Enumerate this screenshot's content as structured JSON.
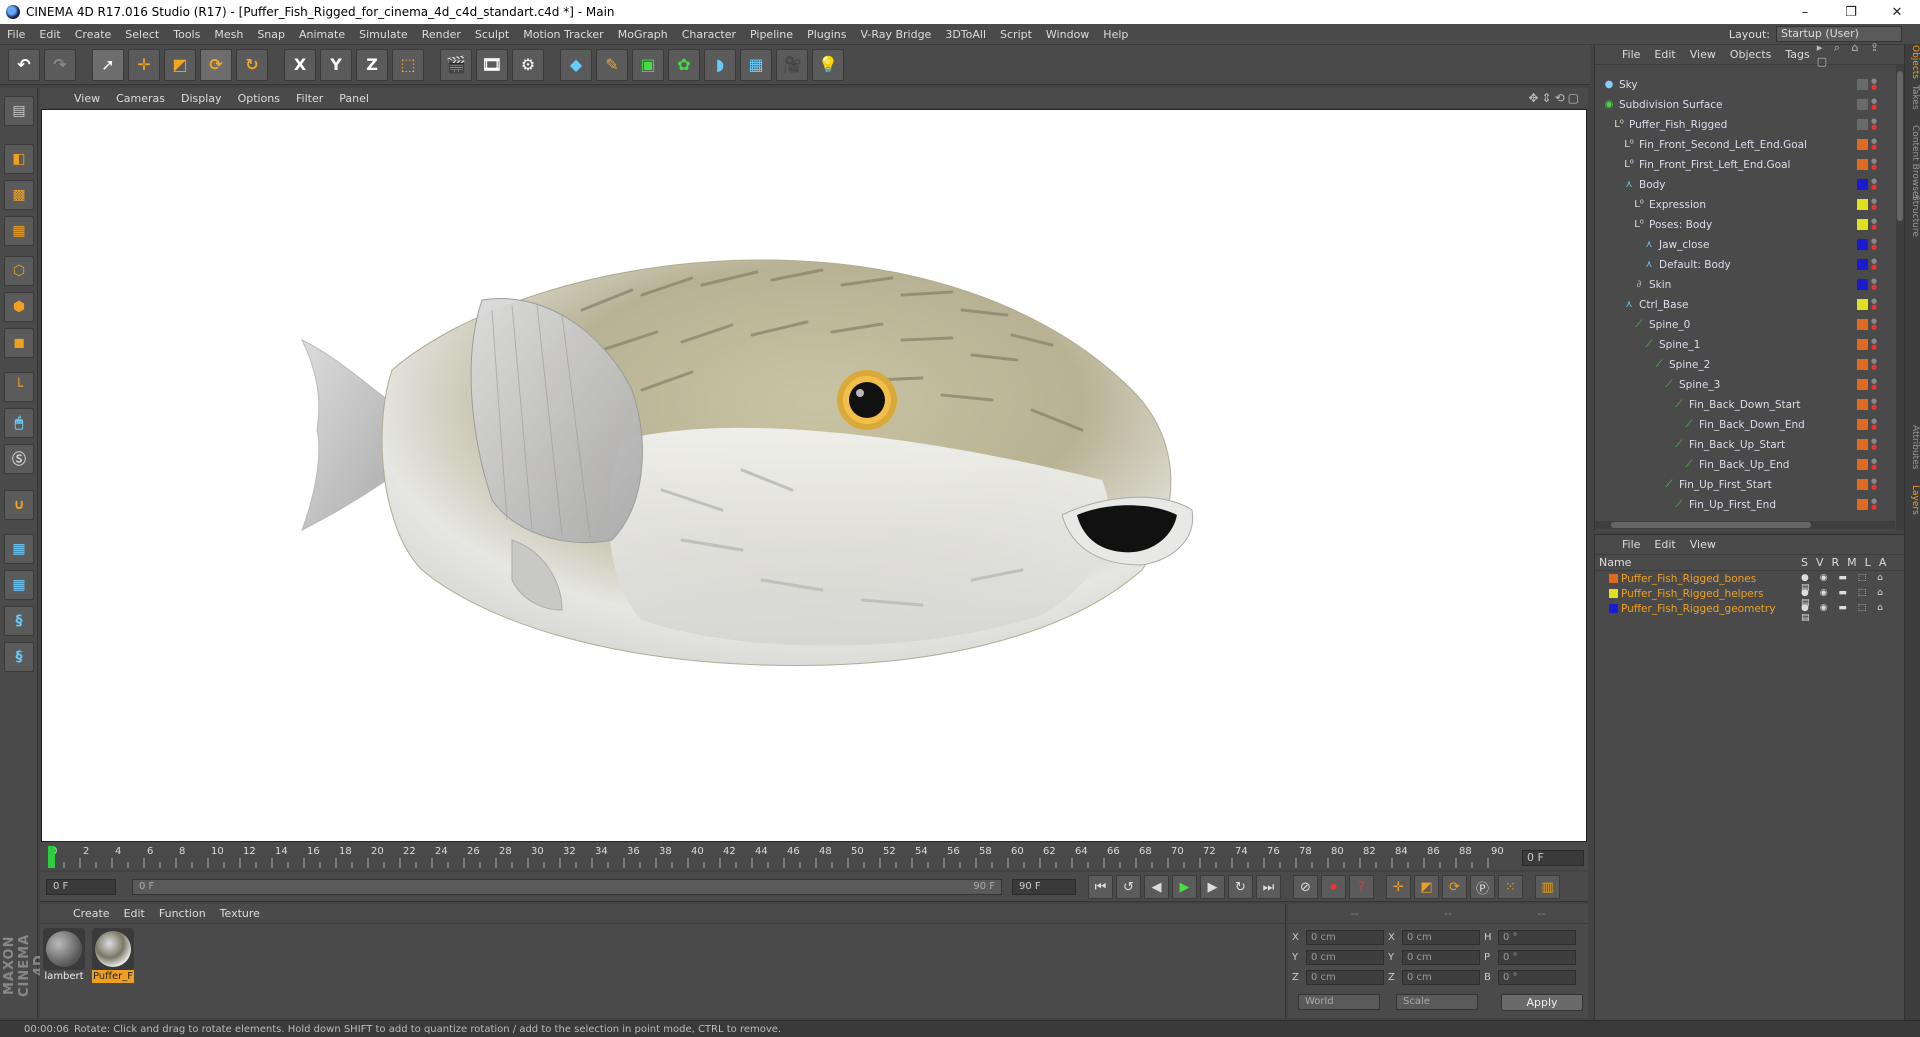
{
  "window": {
    "title": "CINEMA 4D R17.016 Studio (R17) - [Puffer_Fish_Rigged_for_cinema_4d_c4d_standart.c4d *] - Main",
    "controls": [
      "–",
      "❐",
      "✕"
    ]
  },
  "menubar": {
    "items": [
      "File",
      "Edit",
      "Create",
      "Select",
      "Tools",
      "Mesh",
      "Snap",
      "Animate",
      "Simulate",
      "Render",
      "Sculpt",
      "Motion Tracker",
      "MoGraph",
      "Character",
      "Pipeline",
      "Plugins",
      "V-Ray Bridge",
      "3DToAll",
      "Script",
      "Window",
      "Help"
    ],
    "layout_label": "Layout:",
    "layout_value": "Startup (User)"
  },
  "toolbar": {
    "icons": [
      "undo-icon",
      "redo-icon",
      "live-selection-icon",
      "move-icon",
      "scale-icon",
      "rotate-icon",
      "recent-tool-icon",
      "x-axis-icon",
      "y-axis-icon",
      "z-axis-icon",
      "coordinate-system-icon",
      "render-view-icon",
      "render-picture-viewer-icon",
      "render-settings-icon",
      "cube-icon",
      "pen-icon",
      "subdivision-icon",
      "mograph-cloner-icon",
      "deformer-icon",
      "floor-icon",
      "camera-icon",
      "light-icon"
    ],
    "axis_x": "X",
    "axis_y": "Y",
    "axis_z": "Z"
  },
  "viewport": {
    "menu": [
      "View",
      "Cameras",
      "Display",
      "Options",
      "Filter",
      "Panel"
    ],
    "nav_icons": "✥⇕⟲▢"
  },
  "timeline": {
    "ticks": [
      "0",
      "2",
      "4",
      "6",
      "8",
      "10",
      "12",
      "14",
      "16",
      "18",
      "20",
      "22",
      "24",
      "26",
      "28",
      "30",
      "32",
      "34",
      "36",
      "38",
      "40",
      "42",
      "44",
      "46",
      "48",
      "50",
      "52",
      "54",
      "56",
      "58",
      "60",
      "62",
      "64",
      "66",
      "68",
      "70",
      "72",
      "74",
      "76",
      "78",
      "80",
      "82",
      "84",
      "86",
      "88",
      "90"
    ],
    "current_frame": "0 F"
  },
  "transport": {
    "start": "0 F",
    "slider_start": "0 F",
    "slider_end": "90 F",
    "end": "90 F"
  },
  "materials": {
    "menu": [
      "Create",
      "Edit",
      "Function",
      "Texture"
    ],
    "items": [
      {
        "name": "lambert",
        "selected": false
      },
      {
        "name": "Puffer_F",
        "selected": true
      }
    ]
  },
  "coordinates": {
    "headers": [
      "--",
      "--",
      "--"
    ],
    "rows": [
      {
        "a": "X",
        "av": "0 cm",
        "b": "X",
        "bv": "0 cm",
        "c": "H",
        "cv": "0 °"
      },
      {
        "a": "Y",
        "av": "0 cm",
        "b": "Y",
        "bv": "0 cm",
        "c": "P",
        "cv": "0 °"
      },
      {
        "a": "Z",
        "av": "0 cm",
        "b": "Z",
        "bv": "0 cm",
        "c": "B",
        "cv": "0 °"
      }
    ],
    "world": "World",
    "scale": "Scale",
    "apply": "Apply"
  },
  "status": {
    "time": "00:00:06",
    "message": "Rotate: Click and drag to rotate elements. Hold down SHIFT to add to quantize rotation / add to the selection in point mode, CTRL to remove."
  },
  "object_manager": {
    "menu": [
      "File",
      "Edit",
      "View",
      "Objects",
      "Tags"
    ],
    "objects": [
      {
        "name": "Sky",
        "indent": 0,
        "icon": "sky-icon",
        "tag": "#6a6a6a"
      },
      {
        "name": "Subdivision Surface",
        "indent": 0,
        "icon": "subdivision-icon",
        "tag": "#6a6a6a"
      },
      {
        "name": "Puffer_Fish_Rigged",
        "indent": 1,
        "icon": "null-icon",
        "tag": "#6a6a6a"
      },
      {
        "name": "Fin_Front_Second_Left_End.Goal",
        "indent": 2,
        "icon": "null-icon",
        "tag": "#e06a20"
      },
      {
        "name": "Fin_Front_First_Left_End.Goal",
        "indent": 2,
        "icon": "null-icon",
        "tag": "#e06a20"
      },
      {
        "name": "Body",
        "indent": 2,
        "icon": "mesh-icon",
        "tag": "#1a1ad0"
      },
      {
        "name": "Expression",
        "indent": 3,
        "icon": "null-icon",
        "tag": "#e0e020"
      },
      {
        "name": "Poses: Body",
        "indent": 3,
        "icon": "null-icon",
        "tag": "#e0e020"
      },
      {
        "name": "Jaw_close",
        "indent": 4,
        "icon": "mesh-icon",
        "tag": "#1a1ad0"
      },
      {
        "name": "Default: Body",
        "indent": 4,
        "icon": "mesh-icon",
        "tag": "#1a1ad0"
      },
      {
        "name": "Skin",
        "indent": 3,
        "icon": "skin-icon",
        "tag": "#1a1ad0"
      },
      {
        "name": "Ctrl_Base",
        "indent": 2,
        "icon": "mesh-icon",
        "tag": "#e0e020"
      },
      {
        "name": "Spine_0",
        "indent": 3,
        "icon": "joint-icon",
        "tag": "#e06a20"
      },
      {
        "name": "Spine_1",
        "indent": 4,
        "icon": "joint-icon",
        "tag": "#e06a20"
      },
      {
        "name": "Spine_2",
        "indent": 5,
        "icon": "joint-icon",
        "tag": "#e06a20"
      },
      {
        "name": "Spine_3",
        "indent": 6,
        "icon": "joint-icon",
        "tag": "#e06a20"
      },
      {
        "name": "Fin_Back_Down_Start",
        "indent": 7,
        "icon": "joint-icon",
        "tag": "#e06a20"
      },
      {
        "name": "Fin_Back_Down_End",
        "indent": 8,
        "icon": "joint-icon",
        "tag": "#e06a20"
      },
      {
        "name": "Fin_Back_Up_Start",
        "indent": 7,
        "icon": "joint-icon",
        "tag": "#e06a20"
      },
      {
        "name": "Fin_Back_Up_End",
        "indent": 8,
        "icon": "joint-icon",
        "tag": "#e06a20"
      },
      {
        "name": "Fin_Up_First_Start",
        "indent": 6,
        "icon": "joint-icon",
        "tag": "#e06a20"
      },
      {
        "name": "Fin_Up_First_End",
        "indent": 7,
        "icon": "joint-icon",
        "tag": "#e06a20"
      }
    ]
  },
  "layer_manager": {
    "menu": [
      "File",
      "Edit",
      "View"
    ],
    "name_col": "Name",
    "cols": [
      "S",
      "V",
      "R",
      "M",
      "L",
      "A"
    ],
    "layers": [
      {
        "name": "Puffer_Fish_Rigged_bones",
        "color": "#e06a20"
      },
      {
        "name": "Puffer_Fish_Rigged_helpers",
        "color": "#e0e020"
      },
      {
        "name": "Puffer_Fish_Rigged_geometry",
        "color": "#1a1ad0"
      }
    ]
  },
  "right_tabs": [
    "Objects",
    "Takes",
    "Content Browser",
    "Structure",
    "Attributes",
    "Layers"
  ]
}
